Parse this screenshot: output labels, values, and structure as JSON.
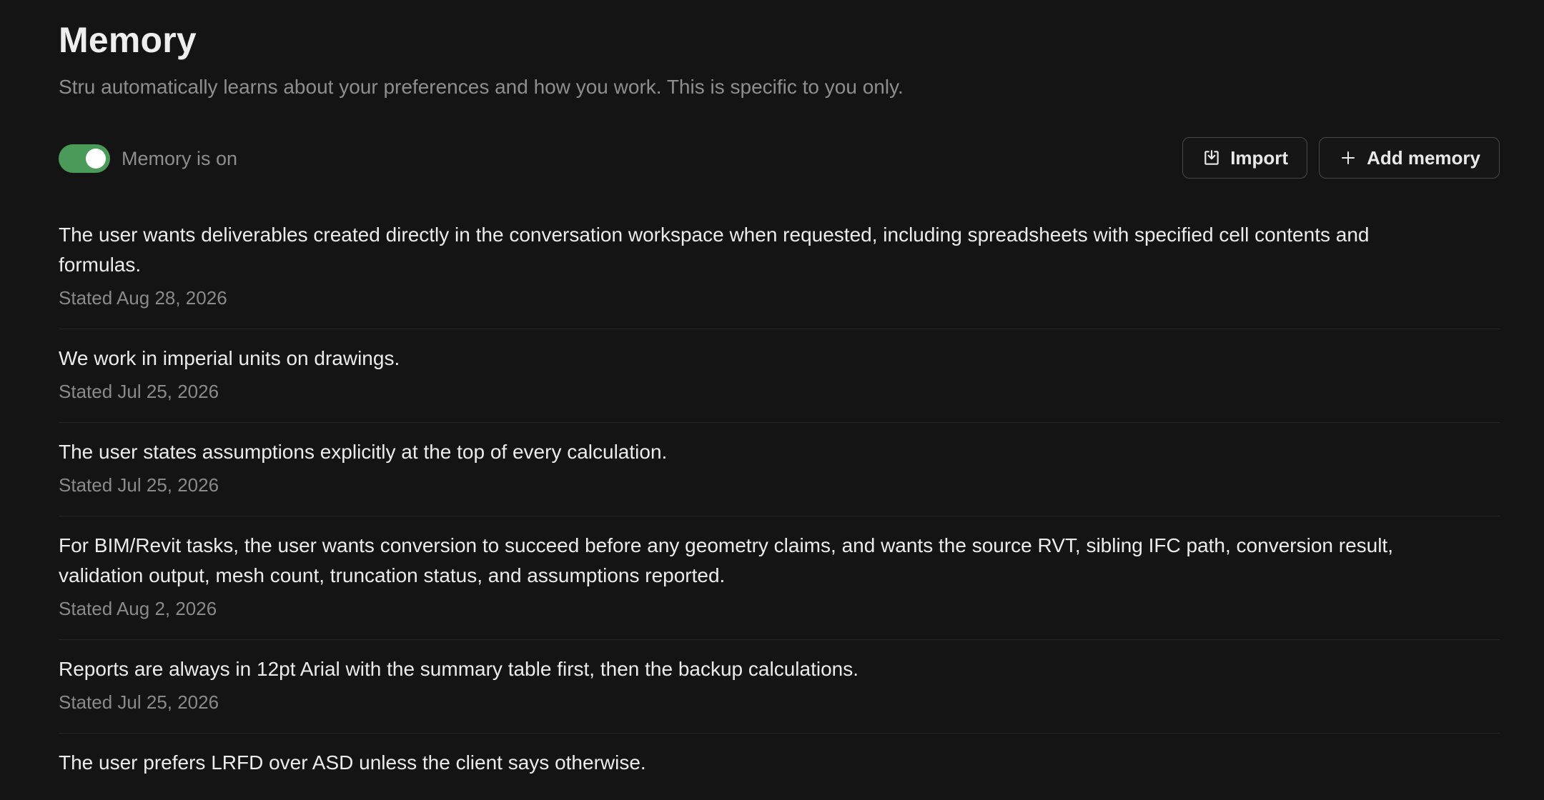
{
  "header": {
    "title": "Memory",
    "subtitle": "Stru automatically learns about your preferences and how you work. This is specific to you only."
  },
  "toggle": {
    "state": "on",
    "label": "Memory is on",
    "color": "#4a9b5a"
  },
  "actions": {
    "import_label": "Import",
    "import_icon": "import-icon",
    "add_label": "Add memory",
    "add_icon": "plus-icon"
  },
  "memories": [
    {
      "text": "The user wants deliverables created directly in the conversation workspace when requested, including spreadsheets with specified cell contents and formulas.",
      "date": "Stated Aug 28, 2026"
    },
    {
      "text": "We work in imperial units on drawings.",
      "date": "Stated Jul 25, 2026"
    },
    {
      "text": "The user states assumptions explicitly at the top of every calculation.",
      "date": "Stated Jul 25, 2026"
    },
    {
      "text": "For BIM/Revit tasks, the user wants conversion to succeed before any geometry claims, and wants the source RVT, sibling IFC path, conversion result, validation output, mesh count, truncation status, and assumptions reported.",
      "date": "Stated Aug 2, 2026"
    },
    {
      "text": "Reports are always in 12pt Arial with the summary table first, then the backup calculations.",
      "date": "Stated Jul 25, 2026"
    },
    {
      "text": "The user prefers LRFD over ASD unless the client says otherwise.",
      "date": ""
    }
  ]
}
